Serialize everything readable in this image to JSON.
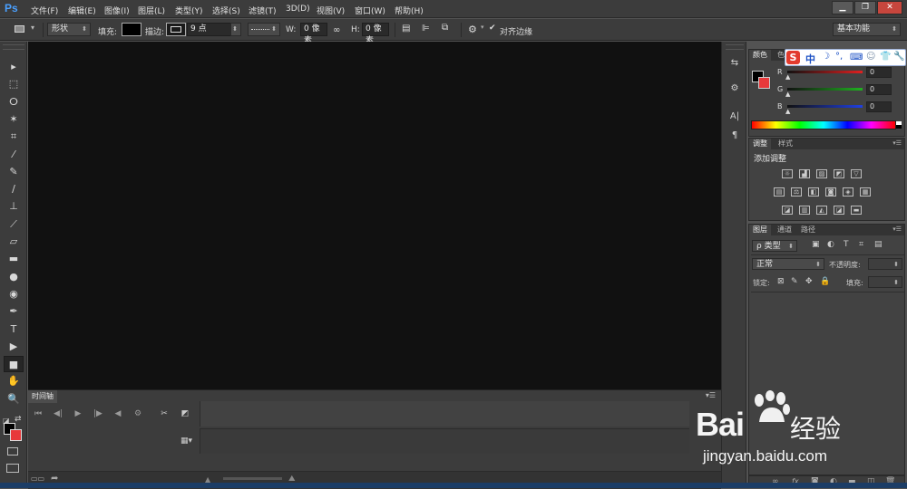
{
  "app": {
    "logo": "Ps"
  },
  "menubar": {
    "items": [
      "文件(F)",
      "编辑(E)",
      "图像(I)",
      "图层(L)",
      "类型(Y)",
      "选择(S)",
      "滤镜(T)",
      "3D(D)",
      "视图(V)",
      "窗口(W)",
      "帮助(H)"
    ],
    "window_buttons": [
      "▁",
      "❐",
      "✕"
    ]
  },
  "options_bar": {
    "mode": "形状",
    "fill_label": "填充:",
    "stroke_label": "描边:",
    "stroke_size": "9 点",
    "w_label": "W:",
    "w_value": "0 像素",
    "h_label": "H:",
    "h_value": "0 像素",
    "align_edges_label": "对齐边缘",
    "align_edges_checked": true,
    "workspace": "基本功能"
  },
  "tools": [
    "move-icon",
    "marquee-icon",
    "lasso-icon",
    "magic-wand-icon",
    "crop-icon",
    "eyedropper-icon",
    "healing-brush-icon",
    "brush-icon",
    "clone-stamp-icon",
    "history-brush-icon",
    "eraser-icon",
    "gradient-icon",
    "blur-icon",
    "dodge-icon",
    "pen-icon",
    "type-icon",
    "path-select-icon",
    "rectangle-icon",
    "hand-icon",
    "zoom-icon"
  ],
  "tool_glyphs": [
    "▸",
    "⬚",
    "ⵔ",
    "✶",
    "⌗",
    "⁄",
    "✎",
    "∕",
    "⊥",
    "⟋",
    "▱",
    "▬",
    "●",
    "◉",
    "✒",
    "T",
    "▶",
    "■",
    "✋",
    "🔍"
  ],
  "active_tool": "rectangle-icon",
  "colors": {
    "foreground": "#000000",
    "background": "#e8393b",
    "accent": "#4aa0ff"
  },
  "timeline": {
    "tab": "时间轴",
    "controls": [
      "⏮",
      "◀|",
      "▶",
      "|▶",
      "◀",
      "⚙",
      "✂",
      "◩"
    ]
  },
  "color_panel": {
    "tabs": [
      "颜色",
      "色"
    ],
    "channels": [
      {
        "label": "R",
        "value": "0",
        "color": "#e02020"
      },
      {
        "label": "G",
        "value": "0",
        "color": "#20b020"
      },
      {
        "label": "B",
        "value": "0",
        "color": "#2040e0"
      }
    ]
  },
  "adjustments_panel": {
    "tabs": [
      "调整",
      "样式"
    ],
    "title": "添加调整",
    "icon_rows": [
      [
        "brightness-icon",
        "levels-icon",
        "curves-icon",
        "exposure-icon",
        "vibrance-icon"
      ],
      [
        "hue-sat-icon",
        "color-balance-icon",
        "bw-icon",
        "photo-filter-icon",
        "channel-mixer-icon",
        "color-lookup-icon"
      ],
      [
        "invert-icon",
        "posterize-icon",
        "threshold-icon",
        "selective-color-icon",
        "gradient-map-icon"
      ]
    ]
  },
  "layers_panel": {
    "tabs": [
      "图层",
      "通道",
      "路径"
    ],
    "filter_kind": "ρ 类型",
    "blend_mode": "正常",
    "opacity_label": "不透明度:",
    "lock_label": "锁定:",
    "fill_label": "填充:"
  },
  "ime": {
    "logo": "S",
    "mode": "中"
  },
  "watermark": {
    "brand": "Bai",
    "brand2": "经验",
    "url": "jingyan.baidu.com"
  }
}
